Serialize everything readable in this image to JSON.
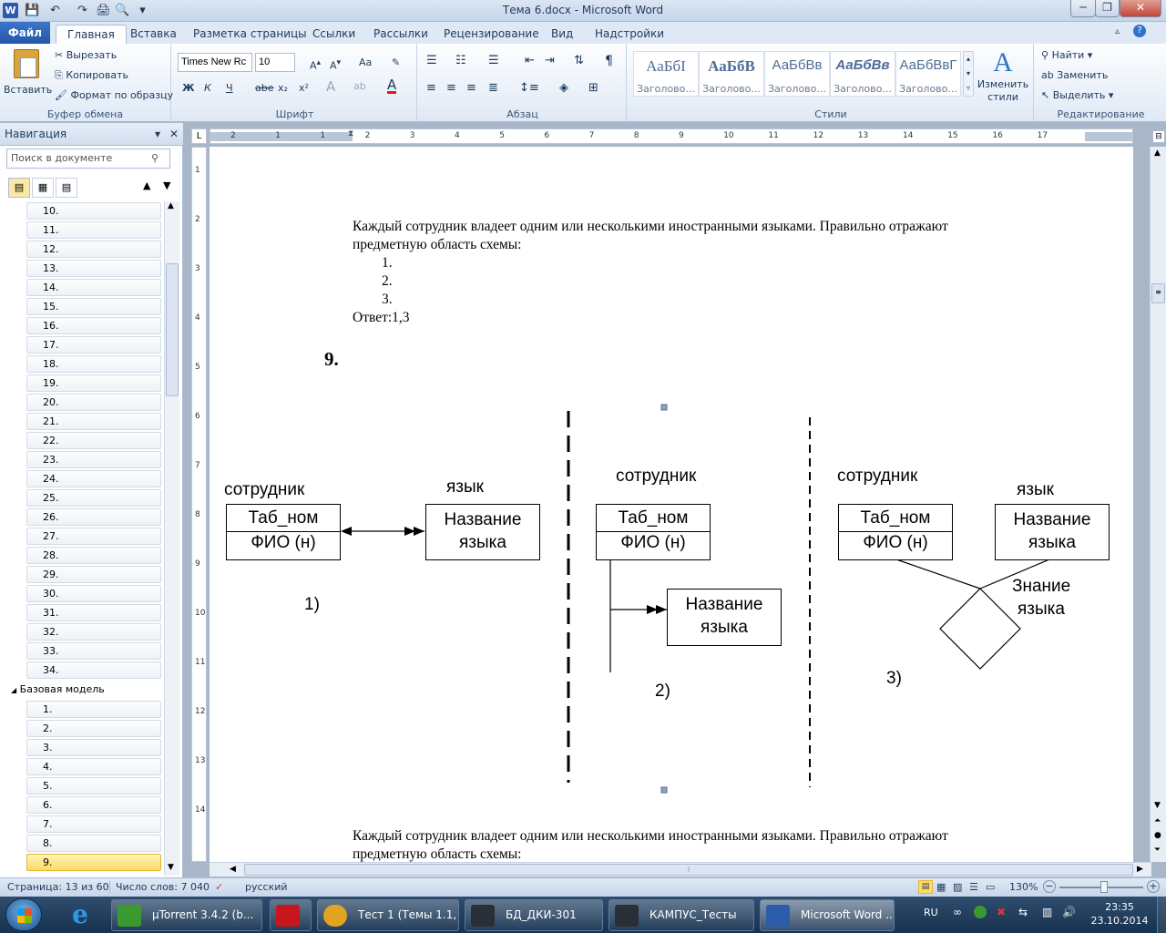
{
  "window": {
    "title": "Тема 6.docx - Microsoft Word"
  },
  "quick_access": [
    "save-icon",
    "undo-icon",
    "redo-icon",
    "print-preview-icon",
    "customize-icon"
  ],
  "tabs": [
    {
      "label": "Файл"
    },
    {
      "label": "Главная"
    },
    {
      "label": "Вставка"
    },
    {
      "label": "Разметка страницы"
    },
    {
      "label": "Ссылки"
    },
    {
      "label": "Рассылки"
    },
    {
      "label": "Рецензирование"
    },
    {
      "label": "Вид"
    },
    {
      "label": "Надстройки"
    }
  ],
  "ribbon": {
    "clipboard": {
      "group": "Буфер обмена",
      "paste": "Вставить",
      "cut": "Вырезать",
      "copy": "Копировать",
      "format_painter": "Формат по образцу"
    },
    "font": {
      "group": "Шрифт",
      "font_name": "Times New Rc",
      "font_size": "10",
      "bold": "Ж",
      "italic": "К",
      "underline": "Ч",
      "strike": "abe",
      "sub": "x₂",
      "sup": "x²",
      "case": "Aa"
    },
    "paragraph": {
      "group": "Абзац"
    },
    "styles": {
      "group": "Стили",
      "items": [
        {
          "sample": "АаБбI",
          "name": "Заголово..."
        },
        {
          "sample": "АаБбВ",
          "name": "Заголово..."
        },
        {
          "sample": "АаБбВв",
          "name": "Заголово..."
        },
        {
          "sample": "АаБбВв",
          "name": "Заголово..."
        },
        {
          "sample": "АаБбВвГ",
          "name": "Заголово..."
        }
      ],
      "change": "Изменить стили"
    },
    "editing": {
      "group": "Редактирование",
      "find": "Найти",
      "replace": "Заменить",
      "select": "Выделить"
    }
  },
  "nav": {
    "title": "Навигация",
    "search_placeholder": "Поиск в документе",
    "items_a": [
      "10.",
      "11.",
      "12.",
      "13.",
      "14.",
      "15.",
      "16.",
      "17.",
      "18.",
      "19.",
      "20.",
      "21.",
      "22.",
      "23.",
      "24.",
      "25.",
      "26.",
      "27.",
      "28.",
      "29.",
      "30.",
      "31.",
      "32.",
      "33.",
      "34."
    ],
    "heading": "Базовая модель",
    "items_b": [
      "1.",
      "2.",
      "3.",
      "4.",
      "5.",
      "6.",
      "7.",
      "8.",
      "9."
    ],
    "selected": "9."
  },
  "ruler": {
    "h_ticks": [
      "2",
      "1",
      "1",
      "2",
      "3",
      "4",
      "5",
      "6",
      "7",
      "8",
      "9",
      "10",
      "11",
      "12",
      "13",
      "14",
      "15",
      "16",
      "17"
    ],
    "v_ticks": [
      "1",
      "2",
      "3",
      "4",
      "5",
      "6",
      "7",
      "8",
      "9",
      "10",
      "11",
      "12",
      "13",
      "14"
    ]
  },
  "doc": {
    "para1_line1": "Каждый сотрудник владеет одним или несколькими иностранными языками. Правильно отражают",
    "para1_line2": "предметную область схемы:",
    "list": [
      "1.",
      "2.",
      "3."
    ],
    "answer": "Ответ:1,3",
    "question_num": "9.",
    "para2_line1": "Каждый сотрудник владеет одним или несколькими иностранными языками. Правильно отражают",
    "para2_line2": "предметную область схемы:"
  },
  "diagram": {
    "d1": {
      "left_label": "сотрудник",
      "right_label": "язык",
      "left_attr1": "Таб_ном",
      "left_attr2": "ФИО (н)",
      "right_line1": "Название",
      "right_line2": "языка",
      "caption": "1)"
    },
    "d2": {
      "top_label": "сотрудник",
      "attr1": "Таб_ном",
      "attr2": "ФИО (н)",
      "sub_line1": "Название",
      "sub_line2": "языка",
      "caption": "2)"
    },
    "d3": {
      "left_label": "сотрудник",
      "right_label": "язык",
      "left_attr1": "Таб_ном",
      "left_attr2": "ФИО (н)",
      "right_line1": "Название",
      "right_line2": "языка",
      "rel_line1": "Знание",
      "rel_line2": "языка",
      "caption": "3)"
    }
  },
  "status": {
    "page": "Страница: 13 из 60",
    "words": "Число слов: 7 040",
    "lang": "русский",
    "zoom": "130%"
  },
  "taskbar": {
    "items": [
      {
        "label": "µTorrent 3.4.2  (b...",
        "color": "#3b9a2f"
      },
      {
        "label": "",
        "color": "#c7161c"
      },
      {
        "label": "Тест 1 (Темы 1.1, ...",
        "color": "#e2a420"
      },
      {
        "label": "БД_ДКИ-301",
        "color": "#2a2f36"
      },
      {
        "label": "КАМПУС_Тесты",
        "color": "#2a2f36"
      },
      {
        "label": "Microsoft Word ...",
        "color": "#2b5cac"
      }
    ],
    "lang": "RU",
    "time": "23:35",
    "date": "23.10.2014"
  }
}
